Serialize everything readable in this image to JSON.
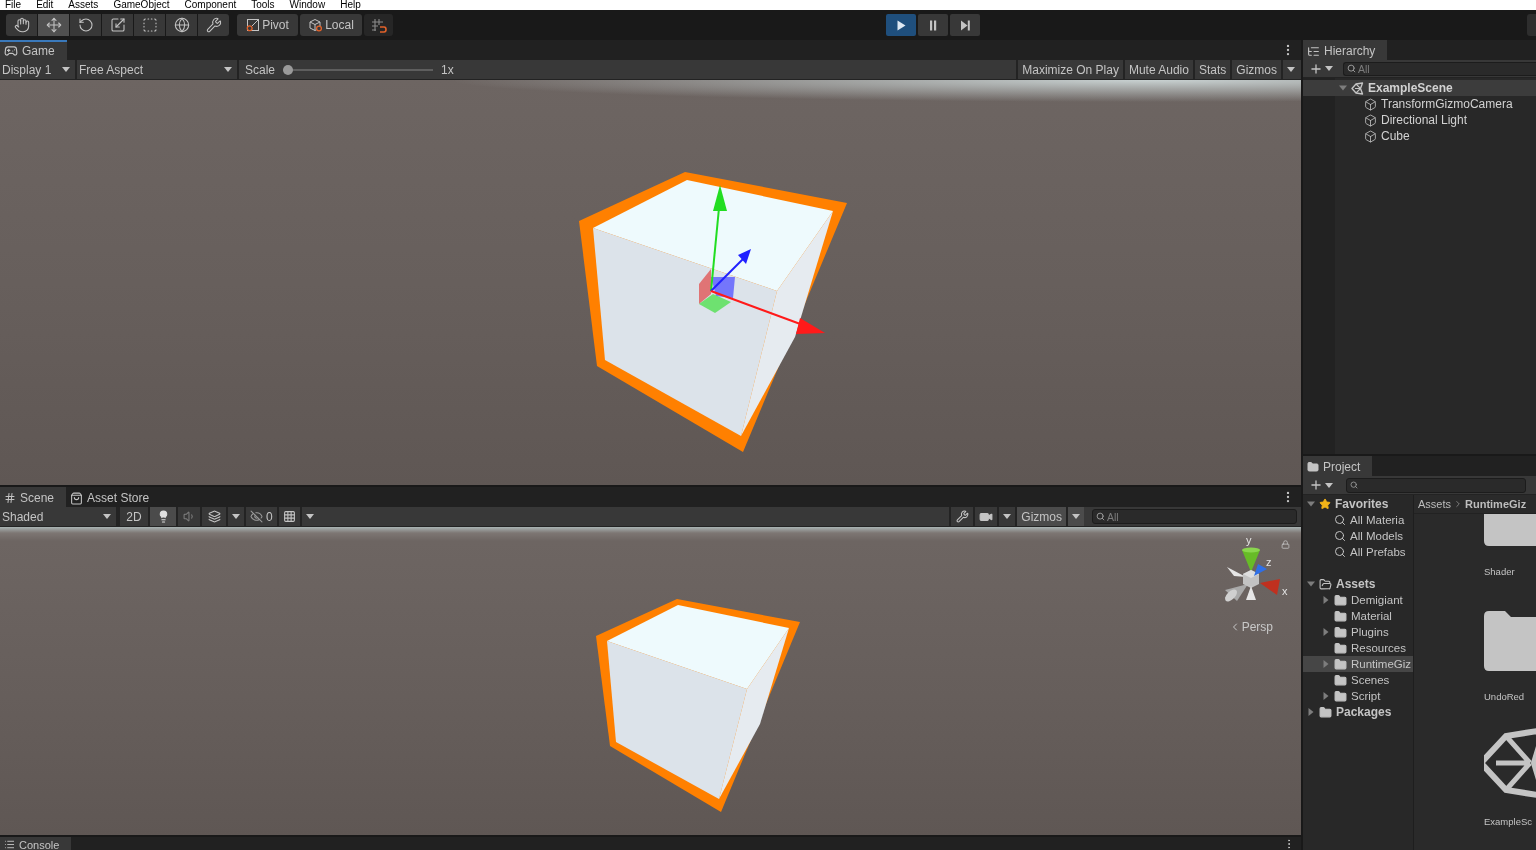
{
  "menu": [
    "File",
    "Edit",
    "Assets",
    "GameObject",
    "Component",
    "Tools",
    "Window",
    "Help"
  ],
  "toolbar": {
    "tools": [
      {
        "kind": "hand",
        "selected": false
      },
      {
        "kind": "move",
        "selected": true
      },
      {
        "kind": "rotate",
        "selected": false
      },
      {
        "kind": "scale",
        "selected": false
      },
      {
        "kind": "rect",
        "selected": false
      },
      {
        "kind": "transform",
        "selected": false
      },
      {
        "kind": "custom",
        "selected": false
      }
    ],
    "handle_modes": [
      {
        "kind": "pivot",
        "label": "Pivot"
      },
      {
        "kind": "space",
        "label": "Local"
      }
    ],
    "playback": [
      {
        "kind": "play",
        "selected": true
      },
      {
        "kind": "pause",
        "selected": false
      },
      {
        "kind": "step",
        "selected": false
      }
    ]
  },
  "game": {
    "tab": {
      "label": "Game",
      "selected": true,
      "focused": true
    },
    "toolbar": {
      "display": "Display 1",
      "aspect": "Free Aspect",
      "scale": {
        "label": "Scale",
        "level": 0,
        "reading": "1x"
      },
      "toggles": [
        {
          "kind": "toggle",
          "label": "Maximize On Play",
          "on": false
        },
        {
          "kind": "toggle",
          "label": "Mute Audio",
          "on": false
        },
        {
          "kind": "toggle",
          "label": "Stats",
          "on": false
        },
        {
          "kind": "menu",
          "label": "Gizmos",
          "on": false
        }
      ]
    }
  },
  "scene": {
    "tabs": [
      {
        "kind": "scene",
        "label": "Scene",
        "selected": true,
        "focused": false
      },
      {
        "kind": "store",
        "label": "Asset Store",
        "selected": false,
        "focused": false
      }
    ],
    "toolbar": {
      "draw_mode": "Shaded",
      "mode_2d": {
        "label": "2D",
        "on": false
      },
      "lighting": {
        "on": true
      },
      "audio": {
        "on": false
      },
      "hidden_count": "0",
      "gizmos": {
        "label": "Gizmos",
        "on": true
      },
      "search": {
        "placeholder": "All"
      }
    },
    "view": {
      "axis_labels": {
        "y": "y",
        "z": "z",
        "x": "x"
      },
      "projection": "Persp"
    }
  },
  "console": {
    "tab": {
      "label": "Console",
      "selected": true,
      "focused": false
    }
  },
  "hierarchy": {
    "tab": {
      "label": "Hierarchy",
      "selected": true,
      "focused": false
    },
    "search": {
      "placeholder": "All"
    },
    "scene": {
      "label": "ExampleScene",
      "expanded": true,
      "children": [
        {
          "label": "TransformGizmoCamera",
          "selected": false
        },
        {
          "label": "Directional Light",
          "selected": false
        },
        {
          "label": "Cube",
          "selected": false
        }
      ]
    }
  },
  "project": {
    "tab": {
      "label": "Project",
      "selected": true,
      "focused": false
    },
    "tree": [
      {
        "kind": "favorites",
        "label": "Favorites",
        "expanded": true,
        "selected": false,
        "children": [
          {
            "kind": "search",
            "label": "All Materia",
            "selected": false
          },
          {
            "kind": "search",
            "label": "All Models",
            "selected": false
          },
          {
            "kind": "search",
            "label": "All Prefabs",
            "selected": false
          }
        ]
      },
      {
        "kind": "folder",
        "label": "Assets",
        "expanded": true,
        "selected": false,
        "children": [
          {
            "kind": "folder",
            "label": "Demigiant",
            "expanded": false,
            "selected": false
          },
          {
            "kind": "folder",
            "label": "Material",
            "selected": false
          },
          {
            "kind": "folder",
            "label": "Plugins",
            "expanded": false,
            "selected": false
          },
          {
            "kind": "folder",
            "label": "Resources",
            "selected": false
          },
          {
            "kind": "folder",
            "label": "RuntimeGiz",
            "expanded": false,
            "selected": true
          },
          {
            "kind": "folder",
            "label": "Scenes",
            "selected": false
          },
          {
            "kind": "folder",
            "label": "Script",
            "expanded": false,
            "selected": false
          }
        ]
      },
      {
        "kind": "folder",
        "label": "Packages",
        "expanded": false,
        "selected": false
      }
    ],
    "breadcrumb": [
      "Assets",
      "RuntimeGiz"
    ],
    "items": [
      {
        "kind": "folder",
        "label": "Shader"
      },
      {
        "kind": "folder",
        "label": "UndoRed"
      },
      {
        "kind": "scene",
        "label": "ExampleSc"
      }
    ]
  }
}
